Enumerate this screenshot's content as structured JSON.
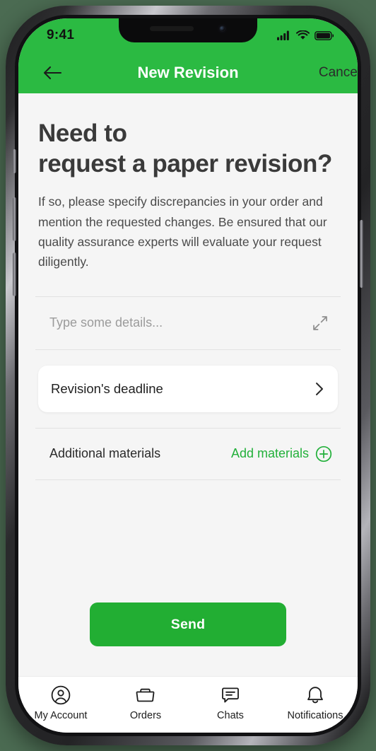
{
  "status_bar": {
    "time": "9:41",
    "icons": [
      "cellular-signal-icon",
      "wifi-icon",
      "battery-icon"
    ]
  },
  "nav": {
    "back_icon": "arrow-left-icon",
    "title": "New Revision",
    "cancel_label": "Cancel"
  },
  "content": {
    "heading_line1": "Need to",
    "heading_line2": "request a paper revision?",
    "body": "If so, please specify discrepancies in your order and mention the requested changes. Be ensured that our quality assurance experts will evaluate your request diligently.",
    "details_placeholder": "Type some details...",
    "details_value": "",
    "expand_icon": "expand-diagonal-icon",
    "deadline_label": "Revision's deadline",
    "deadline_chevron": "chevron-right-icon",
    "materials_label": "Additional materials",
    "add_materials_label": "Add materials",
    "add_materials_icon": "plus-circle-icon",
    "send_label": "Send"
  },
  "tabbar": {
    "items": [
      {
        "label": "My Account",
        "icon": "user-circle-icon"
      },
      {
        "label": "Orders",
        "icon": "folder-icon"
      },
      {
        "label": "Chats",
        "icon": "chat-bubble-icon"
      },
      {
        "label": "Notifications",
        "icon": "bell-icon"
      }
    ]
  },
  "colors": {
    "header_green": "#2bba42",
    "button_green": "#22ae33",
    "accent_green": "#22b03a",
    "sheet_background": "#f5f5f5",
    "page_background": "#4b6b52"
  }
}
